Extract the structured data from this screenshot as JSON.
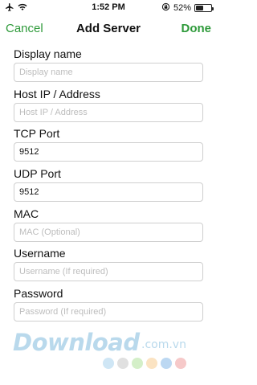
{
  "status_bar": {
    "time": "1:52 PM",
    "battery_text": "52%",
    "battery_level": 0.52,
    "icons": [
      "airplane-icon",
      "wifi-icon",
      "rotation-lock-icon",
      "battery-icon"
    ]
  },
  "nav": {
    "cancel_label": "Cancel",
    "title": "Add Server",
    "done_label": "Done",
    "accent_color": "#2e9a3a"
  },
  "form": {
    "fields": [
      {
        "label": "Display name",
        "value": "",
        "placeholder": "Display name"
      },
      {
        "label": "Host IP / Address",
        "value": "",
        "placeholder": "Host IP / Address"
      },
      {
        "label": "TCP Port",
        "value": "9512",
        "placeholder": ""
      },
      {
        "label": "UDP Port",
        "value": "9512",
        "placeholder": ""
      },
      {
        "label": "MAC",
        "value": "",
        "placeholder": "MAC (Optional)"
      },
      {
        "label": "Username",
        "value": "",
        "placeholder": "Username (If required)"
      },
      {
        "label": "Password",
        "value": "",
        "placeholder": "Password (If required)"
      }
    ]
  },
  "watermark": {
    "text": "Download",
    "suffix": ".com.vn",
    "dot_colors": [
      "#cfe6f5",
      "#e0e0e0",
      "#d4efc8",
      "#fbe3c2",
      "#bcd8f2",
      "#f6c9c9"
    ]
  }
}
